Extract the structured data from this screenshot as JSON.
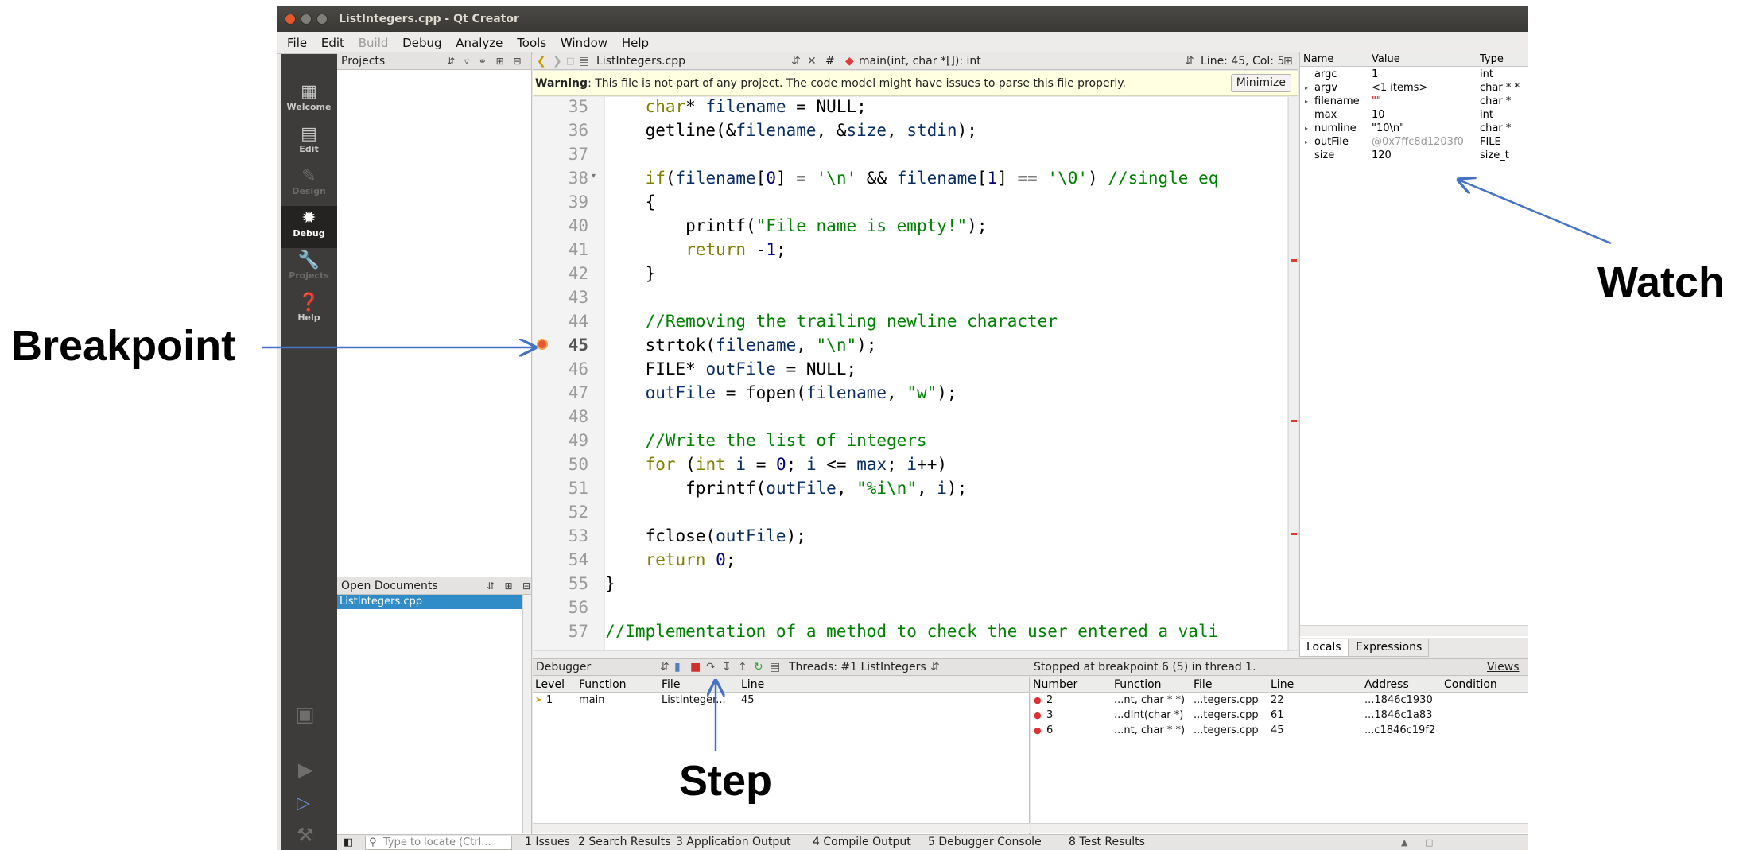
{
  "window": {
    "title": "ListIntegers.cpp - Qt Creator"
  },
  "menu": [
    "File",
    "Edit",
    "Build",
    "Debug",
    "Analyze",
    "Tools",
    "Window",
    "Help"
  ],
  "modes": [
    "Welcome",
    "Edit",
    "Design",
    "Debug",
    "Projects",
    "Help"
  ],
  "projects_panel": {
    "title": "Projects"
  },
  "open_documents": {
    "title": "Open Documents",
    "items": [
      "ListIntegers.cpp"
    ]
  },
  "editor": {
    "file": "ListIntegers.cpp",
    "function": "main(int, char *[]): int",
    "position": "Line: 45, Col: 5",
    "hash": "#",
    "warning_label": "Warning",
    "warning_text": ": This file is not part of any project. The code model might have issues to parse this file properly.",
    "minimize": "Minimize",
    "line_numbers": [
      "35",
      "36",
      "37",
      "38",
      "39",
      "40",
      "41",
      "42",
      "43",
      "44",
      "45",
      "46",
      "47",
      "48",
      "49",
      "50",
      "51",
      "52",
      "53",
      "54",
      "55",
      "56",
      "57"
    ],
    "lines": [
      "    char* filename = NULL;",
      "    getline(&filename, &size, stdin);",
      "",
      "    if(filename[0] = '\\n' && filename[1] == '\\0') //single eq",
      "    {",
      "        printf(\"File name is empty!\");",
      "        return -1;",
      "    }",
      "",
      "    //Removing the trailing newline character",
      "    strtok(filename, \"\\n\");",
      "    FILE* outFile = NULL;",
      "    outFile = fopen(filename, \"w\");",
      "",
      "    //Write the list of integers",
      "    for (int i = 0; i <= max; i++)",
      "        fprintf(outFile, \"%i\\n\", i);",
      "",
      "    fclose(outFile);",
      "    return 0;",
      "}",
      "",
      "//Implementation of a method to check the user entered a vali"
    ],
    "current_line": "45"
  },
  "watch": {
    "headers": [
      "Name",
      "Value",
      "Type"
    ],
    "rows": [
      {
        "name": "argc",
        "value": "1",
        "type": "int",
        "expandable": false
      },
      {
        "name": "argv",
        "value": "<1 items>",
        "type": "char * *",
        "expandable": true
      },
      {
        "name": "filename",
        "value": "\"\"",
        "type": "char *",
        "expandable": true
      },
      {
        "name": "max",
        "value": "10",
        "type": "int",
        "expandable": false
      },
      {
        "name": "numline",
        "value": "\"10\\n\"",
        "type": "char *",
        "expandable": true
      },
      {
        "name": "outFile",
        "value": "@0x7ffc8d1203f0",
        "type": "FILE",
        "expandable": true
      },
      {
        "name": "size",
        "value": "120",
        "type": "size_t",
        "expandable": false
      }
    ],
    "tabs": [
      "Locals",
      "Expressions"
    ]
  },
  "debugger": {
    "title": "Debugger",
    "threads": "Threads: #1 ListIntegers",
    "status": "Stopped at breakpoint 6 (5) in thread 1.",
    "views": "Views",
    "stack_headers": [
      "Level",
      "Function",
      "File",
      "Line"
    ],
    "stack": [
      {
        "level": "1",
        "function": "main",
        "file": "ListInteger...",
        "line": "45"
      }
    ],
    "bp_headers": [
      "Number",
      "Function",
      "File",
      "Line",
      "Address",
      "Condition"
    ],
    "breakpoints": [
      {
        "number": "2",
        "function": "...nt, char * *)",
        "file": "...tegers.cpp",
        "line": "22",
        "address": "...1846c1930"
      },
      {
        "number": "3",
        "function": "...dInt(char *)",
        "file": "...tegers.cpp",
        "line": "61",
        "address": "...1846c1a83"
      },
      {
        "number": "6",
        "function": "...nt, char * *)",
        "file": "...tegers.cpp",
        "line": "45",
        "address": "...c1846c19f2"
      }
    ]
  },
  "statusbar": {
    "locate_placeholder": "Type to locate (Ctrl...",
    "panes": [
      "1 Issues",
      "2 Search Results",
      "3 Application Output",
      "4 Compile Output",
      "5 Debugger Console",
      "8 Test Results"
    ]
  },
  "annotations": {
    "breakpoint": "Breakpoint",
    "watch": "Watch",
    "step": "Step"
  },
  "colors": {
    "accent": "#3d8fd6",
    "arrow": "#4472c4",
    "marker": "#e23a2a"
  }
}
